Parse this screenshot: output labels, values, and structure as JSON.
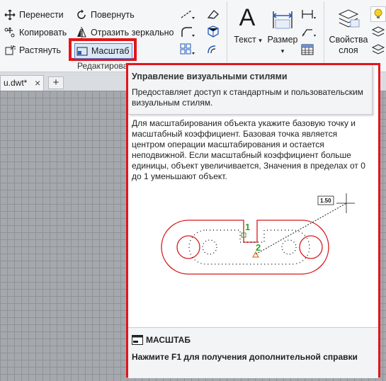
{
  "ribbon": {
    "modify": {
      "move_label": "Перенести",
      "rotate_label": "Повернуть",
      "copy_label": "Копировать",
      "mirror_label": "Отразить зеркально",
      "stretch_label": "Растянуть",
      "scale_label": "Масштаб",
      "panel_label": "Редактирова"
    },
    "annotation": {
      "text_label": "Текст",
      "text_glyph": "A",
      "dimension_label": "Размер"
    },
    "layers": {
      "properties_label_line1": "Свойства",
      "properties_label_line2": "слоя"
    }
  },
  "tabs": {
    "doc_tab_label": "u.dwt*",
    "close_glyph": "×",
    "new_tab_glyph": "+"
  },
  "tooltip": {
    "title": "Управление визуальными стилями",
    "description": "Предоставляет доступ к стандартным и пользовательским визуальным стилям.",
    "body": "Для масштабирования объекта укажите базовую точку и масштабный коэффициент. Базовая точка является центром операции масштабирования и остается неподвижной. Если масштабный коэффициент больше единицы, объект увеличивается, Значения в пределах от 0 до 1 уменьшают объект.",
    "illustration": {
      "scale_value": "1.50",
      "point1_label": "1",
      "point2_label": "2"
    },
    "command_name": "МАСШТАБ",
    "help_text": "Нажмите F1 для получения дополнительной справки"
  },
  "colors": {
    "highlight": "#e3151a",
    "canvas_bg": "#a5a8ad",
    "grid_line": "#8f9297",
    "accent_blue": "#1f5bbf",
    "marker_green": "#2aa52a"
  }
}
